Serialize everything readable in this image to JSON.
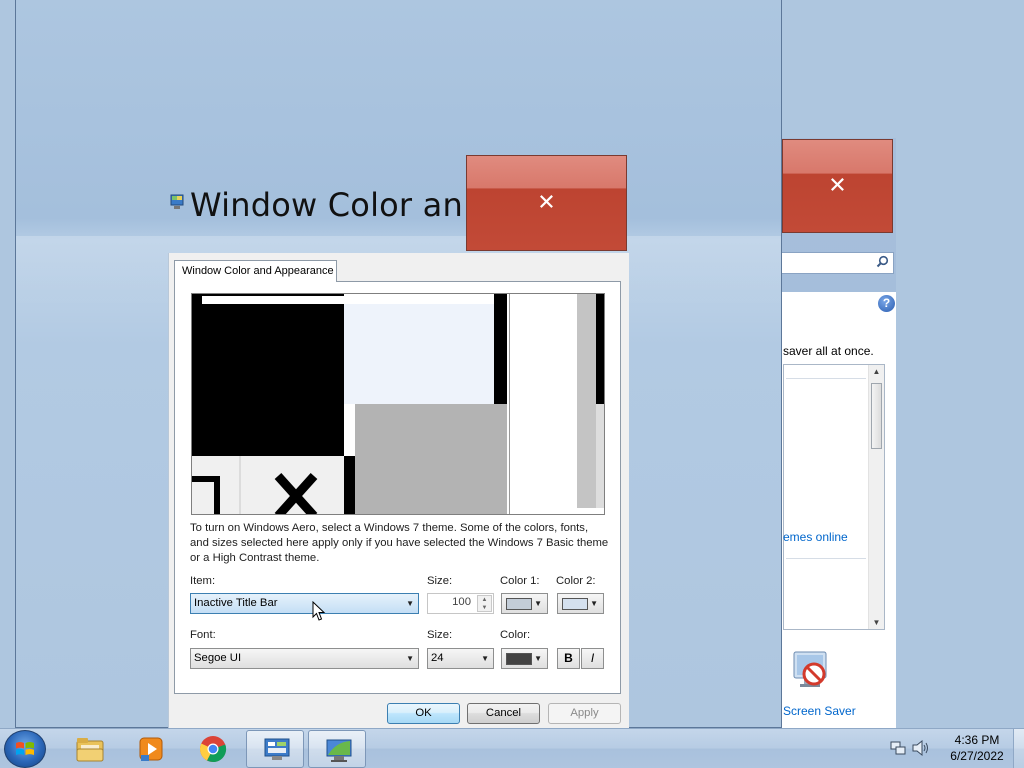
{
  "main_window": {
    "title": "Window Color an...",
    "close_glyph": "✕"
  },
  "back_window": {
    "close_glyph": "✕",
    "search_icon": "search-icon",
    "help_glyph": "?",
    "text": "saver all at once.",
    "link": "emes online",
    "screensaver_label": "Screen Saver"
  },
  "dialog": {
    "tab_label": "Window Color and Appearance",
    "instructions": "To turn on Windows Aero, select a Windows 7 theme.  Some of the colors, fonts, and sizes selected here apply only if you have selected the Windows 7 Basic theme or a High Contrast theme.",
    "item_label": "Item:",
    "item_value": "Inactive Title Bar",
    "size_label": "Size:",
    "size_value": "100",
    "color1_label": "Color 1:",
    "color2_label": "Color 2:",
    "color1_swatch": "#c3cdd8",
    "color2_swatch": "#d4e0ee",
    "font_label": "Font:",
    "font_value": "Segoe UI",
    "font_size_label": "Size:",
    "font_size_value": "24",
    "font_color_label": "Color:",
    "font_color_swatch": "#434343",
    "bold_label": "B",
    "italic_label": "I",
    "ok_label": "OK",
    "cancel_label": "Cancel",
    "apply_label": "Apply"
  },
  "taskbar": {
    "items": [
      "start-button",
      "file-explorer",
      "media-player",
      "chrome",
      "control-panel",
      "window-color"
    ],
    "time": "4:36 PM",
    "date": "6/27/2022"
  }
}
